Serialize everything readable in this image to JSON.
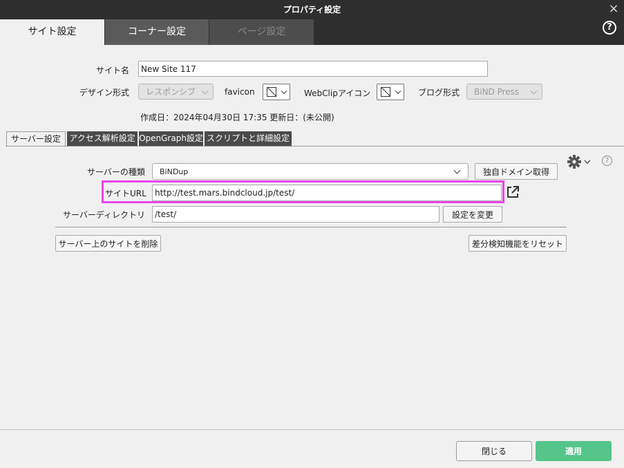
{
  "window": {
    "title": "プロパティ設定"
  },
  "main_tabs": [
    {
      "label": "サイト設定"
    },
    {
      "label": "コーナー設定"
    },
    {
      "label": "ページ設定"
    }
  ],
  "site": {
    "name_label": "サイト名",
    "name_value": "New Site 117",
    "design_label": "デザイン形式",
    "design_value": "レスポンシブ",
    "favicon_label": "favicon",
    "webclip_label": "WebClipアイコン",
    "blog_label": "ブログ形式",
    "blog_value": "BiND Press",
    "dates": "作成日：2024年04月30日 17:35 更新日：(未公開)"
  },
  "sub_tabs": [
    {
      "label": "サーバー設定"
    },
    {
      "label": "アクセス解析設定"
    },
    {
      "label": "OpenGraph設定"
    },
    {
      "label": "スクリプトと詳細設定"
    }
  ],
  "server": {
    "type_label": "サーバーの種類",
    "type_value": "BiNDup",
    "domain_button": "独自ドメイン取得",
    "url_label": "サイトURL",
    "url_value": "http://test.mars.bindcloud.jp/test/",
    "dir_label": "サーバーディレクトリ",
    "dir_value": "/test/",
    "change_button": "設定を変更",
    "delete_button": "サーバー上のサイトを削除",
    "reset_button": "差分検知機能をリセット"
  },
  "footer": {
    "close_button": "閉じる",
    "apply_button": "適用"
  },
  "icons": {
    "help": "?",
    "help_small": "?",
    "close": "×"
  },
  "colors": {
    "apply": "#55c58a",
    "highlight": "#ea44ea",
    "titlebar": "#2e2e2e"
  }
}
